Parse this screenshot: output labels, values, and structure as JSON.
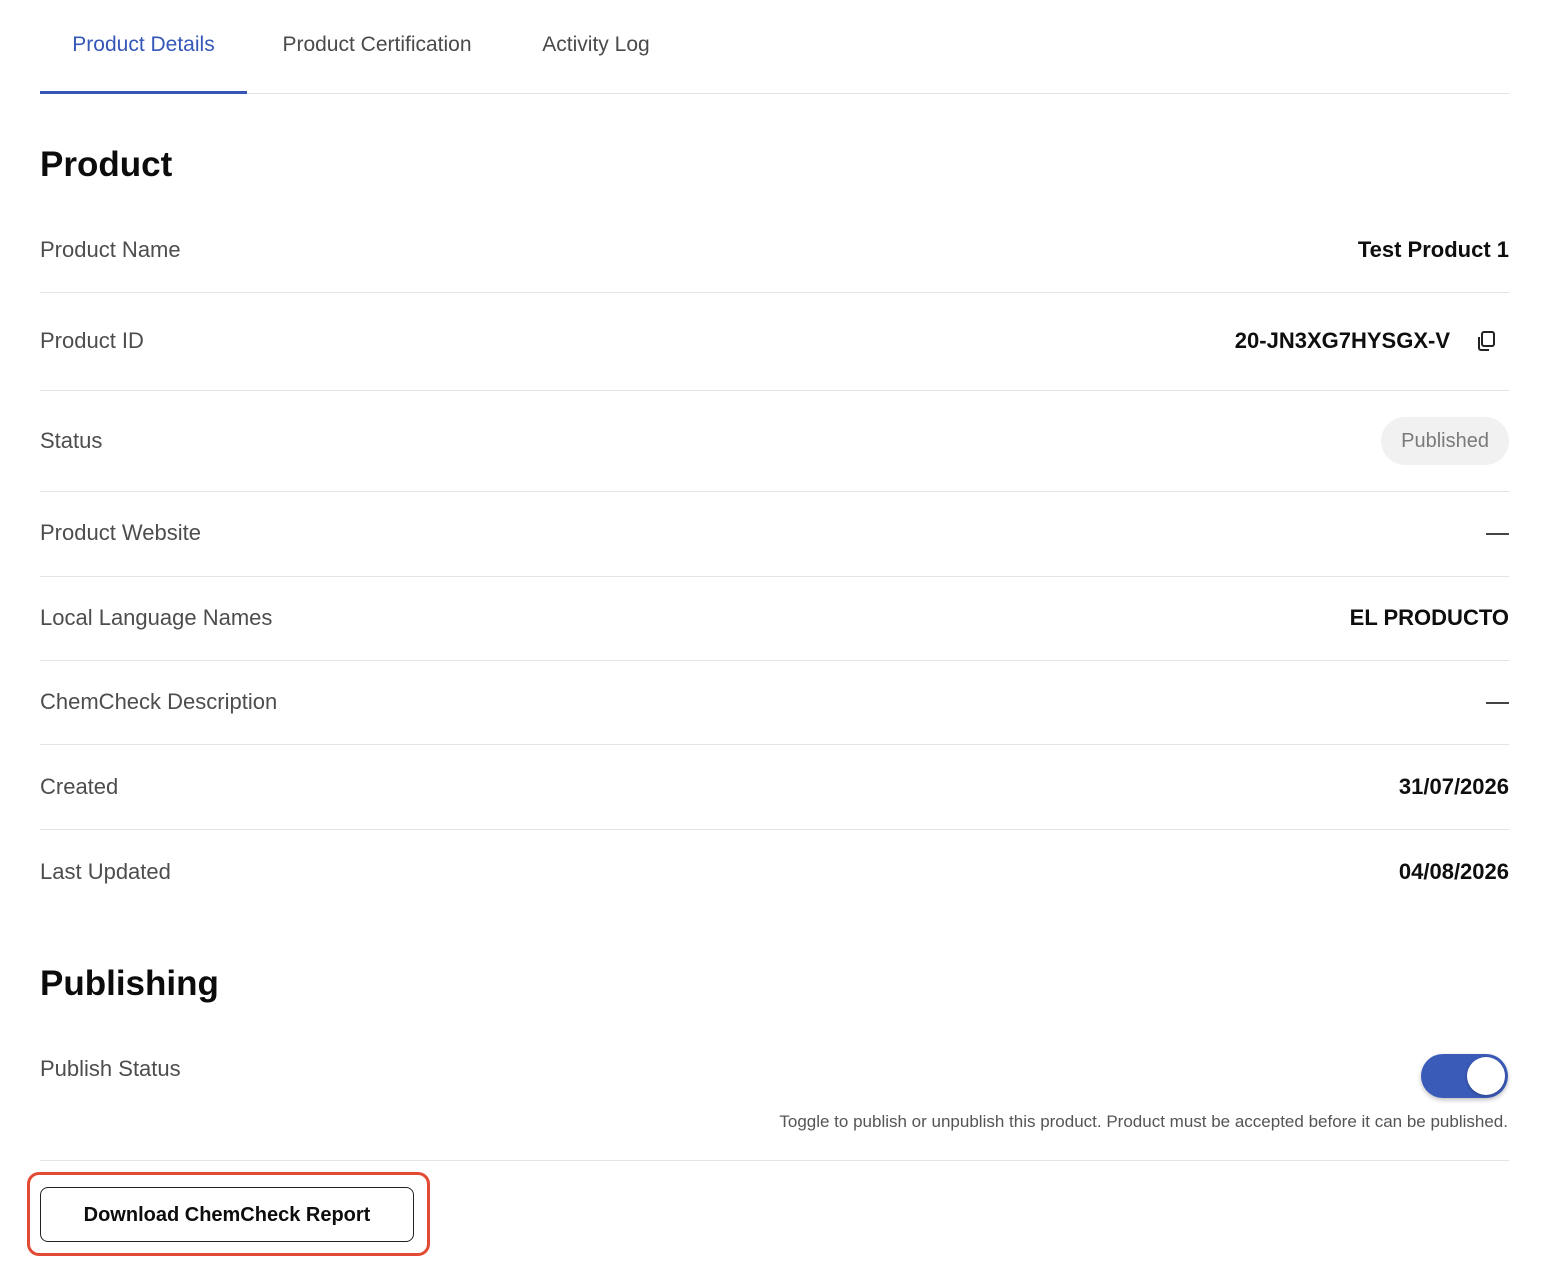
{
  "tabs": [
    {
      "label": "Product Details",
      "active": true
    },
    {
      "label": "Product Certification",
      "active": false
    },
    {
      "label": "Activity Log",
      "active": false
    }
  ],
  "product": {
    "heading": "Product",
    "rows": {
      "name": {
        "label": "Product Name",
        "value": "Test Product 1"
      },
      "id": {
        "label": "Product ID",
        "value": "20-JN3XG7HYSGX-V"
      },
      "status": {
        "label": "Status",
        "value": "Published"
      },
      "website": {
        "label": "Product Website",
        "value": "—"
      },
      "local_names": {
        "label": "Local Language Names",
        "value": "EL PRODUCTO"
      },
      "description": {
        "label": "ChemCheck Description",
        "value": "—"
      },
      "created": {
        "label": "Created",
        "value": "31/07/2026"
      },
      "updated": {
        "label": "Last Updated",
        "value": "04/08/2026"
      }
    }
  },
  "publishing": {
    "heading": "Publishing",
    "publish_status_label": "Publish Status",
    "toggle_on": true,
    "helper_text": "Toggle to publish or unpublish this product. Product must be accepted before it can be published."
  },
  "actions": {
    "download_label": "Download ChemCheck Report"
  },
  "colors": {
    "accent": "#3557b8",
    "toggle": "#3b5bb9",
    "highlight": "#e24a33"
  },
  "icons": {
    "copy": "copy-icon"
  }
}
